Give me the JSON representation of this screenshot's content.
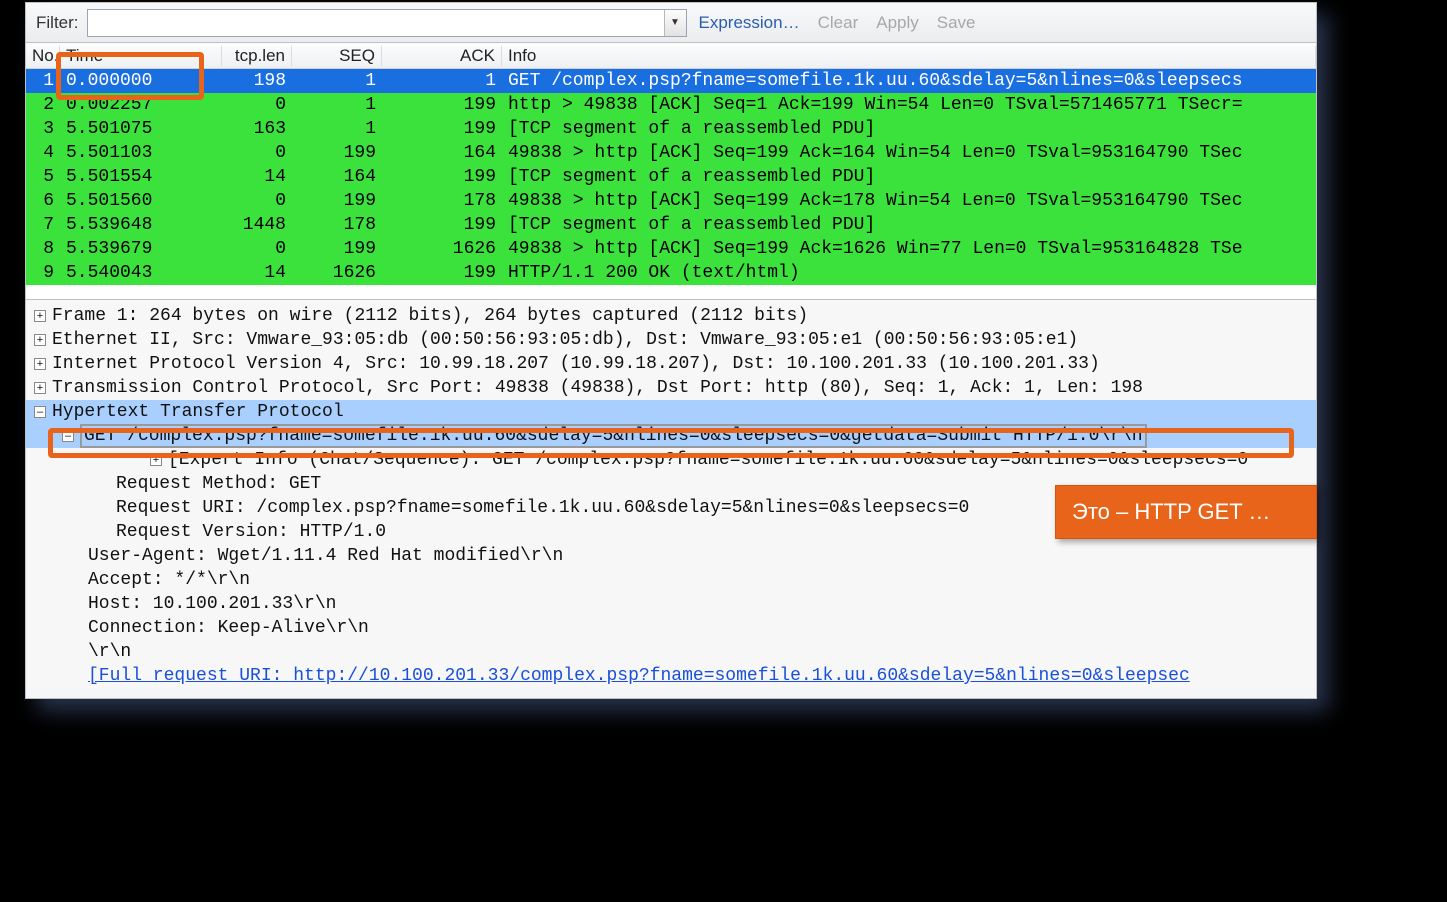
{
  "filter_bar": {
    "label": "Filter:",
    "value": "",
    "expression": "Expression…",
    "clear": "Clear",
    "apply": "Apply",
    "save": "Save"
  },
  "columns": {
    "no": "No.",
    "time": "Time",
    "tcplen": "tcp.len",
    "seq": "SEQ",
    "ack": "ACK",
    "info": "Info"
  },
  "packets": [
    {
      "no": "1",
      "time": "0.000000",
      "len": "198",
      "seq": "1",
      "ack": "1",
      "info": "GET /complex.psp?fname=somefile.1k.uu.60&sdelay=5&nlines=0&sleepsecs",
      "class": "row-selected"
    },
    {
      "no": "2",
      "time": "0.002257",
      "len": "0",
      "seq": "1",
      "ack": "199",
      "info": "http > 49838  [ACK] Seq=1 Ack=199 Win=54 Len=0 TSval=571465771 TSecr=",
      "class": "row-green"
    },
    {
      "no": "3",
      "time": "5.501075",
      "len": "163",
      "seq": "1",
      "ack": "199",
      "info": "[TCP segment of a reassembled PDU]",
      "class": "row-green"
    },
    {
      "no": "4",
      "time": "5.501103",
      "len": "0",
      "seq": "199",
      "ack": "164",
      "info": "49838 > http [ACK] Seq=199 Ack=164 Win=54 Len=0 TSval=953164790 TSec",
      "class": "row-green"
    },
    {
      "no": "5",
      "time": "5.501554",
      "len": "14",
      "seq": "164",
      "ack": "199",
      "info": "[TCP segment of a reassembled PDU]",
      "class": "row-green"
    },
    {
      "no": "6",
      "time": "5.501560",
      "len": "0",
      "seq": "199",
      "ack": "178",
      "info": "49838 > http [ACK] Seq=199 Ack=178 Win=54 Len=0 TSval=953164790 TSec",
      "class": "row-green"
    },
    {
      "no": "7",
      "time": "5.539648",
      "len": "1448",
      "seq": "178",
      "ack": "199",
      "info": "[TCP segment of a reassembled PDU]",
      "class": "row-green"
    },
    {
      "no": "8",
      "time": "5.539679",
      "len": "0",
      "seq": "199",
      "ack": "1626",
      "info": "49838 > http [ACK] Seq=199 Ack=1626 Win=77 Len=0 TSval=953164828 TSe",
      "class": "row-green"
    },
    {
      "no": "9",
      "time": "5.540043",
      "len": "14",
      "seq": "1626",
      "ack": "199",
      "info": "HTTP/1.1 200 OK  (text/html)",
      "class": "row-green"
    }
  ],
  "details": {
    "frame": "Frame 1: 264 bytes on wire (2112 bits), 264 bytes captured (2112 bits)",
    "eth": "Ethernet II, Src: Vmware_93:05:db (00:50:56:93:05:db), Dst: Vmware_93:05:e1 (00:50:56:93:05:e1)",
    "ip": "Internet Protocol Version 4, Src: 10.99.18.207 (10.99.18.207), Dst: 10.100.201.33 (10.100.201.33)",
    "tcp": "Transmission Control Protocol, Src Port: 49838 (49838), Dst Port: http (80), Seq: 1, Ack: 1, Len: 198",
    "http": "Hypertext Transfer Protocol",
    "get": "GET /complex.psp?fname=somefile.1k.uu.60&sdelay=5&nlines=0&sleepsecs=0&getdata=Submit HTTP/1.0\\r\\n",
    "expert": "[Expert Info (Chat/Sequence): GET /complex.psp?fname=somefile.1k.uu.60&sdelay=5&nlines=0&sleepsecs=0",
    "method": "Request Method: GET",
    "uri": "Request URI: /complex.psp?fname=somefile.1k.uu.60&sdelay=5&nlines=0&sleepsecs=0",
    "version": "Request Version: HTTP/1.0",
    "ua": "User-Agent: Wget/1.11.4 Red Hat modified\\r\\n",
    "accept": "Accept: */*\\r\\n",
    "host": "Host: 10.100.201.33\\r\\n",
    "conn": "Connection: Keep-Alive\\r\\n",
    "crlf": "\\r\\n",
    "fulluri": "[Full request URI: http://10.100.201.33/complex.psp?fname=somefile.1k.uu.60&sdelay=5&nlines=0&sleepsec"
  },
  "annotation": "Это – HTTP GET …"
}
